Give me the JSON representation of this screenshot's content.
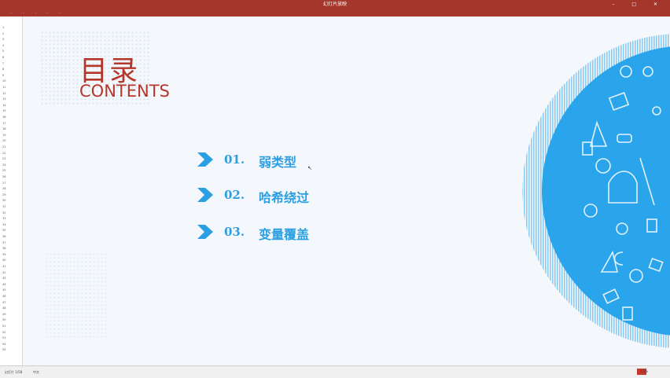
{
  "window": {
    "title": "幻灯片放映"
  },
  "slide": {
    "title_cn": "目录",
    "title_en": "CONTENTS",
    "toc": [
      {
        "num": "01.",
        "label": "弱类型"
      },
      {
        "num": "02.",
        "label": "哈希绕过"
      },
      {
        "num": "03.",
        "label": "变量覆盖"
      }
    ]
  },
  "rail_numbers": [
    "1",
    "2",
    "3",
    "4",
    "5",
    "6",
    "7",
    "8",
    "9",
    "10",
    "11",
    "12",
    "13",
    "14",
    "15",
    "16",
    "17",
    "18",
    "19",
    "20",
    "21",
    "22",
    "23",
    "24",
    "25",
    "26",
    "27",
    "28",
    "29",
    "30",
    "31",
    "32",
    "33",
    "34",
    "35",
    "36",
    "37",
    "38",
    "39",
    "40",
    "41",
    "42",
    "43",
    "44",
    "45",
    "46",
    "47",
    "48",
    "49",
    "50",
    "51",
    "52",
    "53",
    "54",
    "55"
  ],
  "status": {
    "slide_info": "幻灯片 1/58",
    "lang": "中文",
    "zoom": "61%"
  },
  "colors": {
    "accent_red": "#b5372c",
    "title_bar": "#a5362b",
    "blue": "#2c9fe3"
  }
}
